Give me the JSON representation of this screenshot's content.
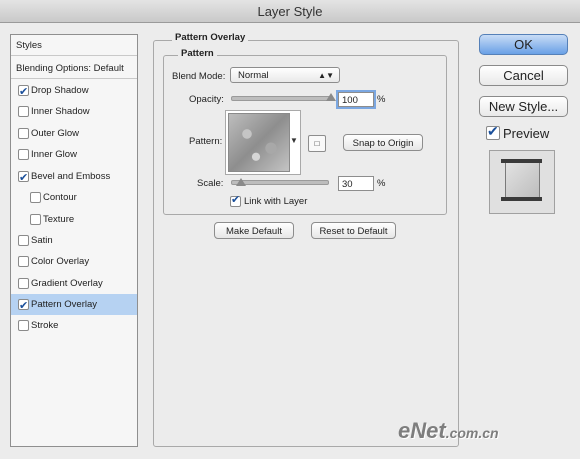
{
  "window": {
    "title": "Layer Style"
  },
  "styles_list": {
    "items": [
      {
        "label": "Styles"
      },
      {
        "label": "Blending Options: Default"
      },
      {
        "label": "Drop Shadow",
        "checked": true
      },
      {
        "label": "Inner Shadow",
        "checked": false
      },
      {
        "label": "Outer Glow",
        "checked": false
      },
      {
        "label": "Inner Glow",
        "checked": false
      },
      {
        "label": "Bevel and Emboss",
        "checked": true
      },
      {
        "label": "Contour",
        "checked": false
      },
      {
        "label": "Texture",
        "checked": false
      },
      {
        "label": "Satin",
        "checked": false
      },
      {
        "label": "Color Overlay",
        "checked": false
      },
      {
        "label": "Gradient Overlay",
        "checked": false
      },
      {
        "label": "Pattern Overlay",
        "checked": true
      },
      {
        "label": "Stroke",
        "checked": false
      }
    ],
    "selected": "Pattern Overlay"
  },
  "pattern_overlay": {
    "group_title": "Pattern Overlay",
    "section_title": "Pattern",
    "blend_mode_label": "Blend Mode:",
    "blend_mode_value": "Normal",
    "opacity_label": "Opacity:",
    "opacity_value": "100",
    "opacity_unit": "%",
    "opacity_level": 1.0,
    "pattern_label": "Pattern:",
    "snap_button": "Snap to Origin",
    "scale_label": "Scale:",
    "scale_value": "30",
    "scale_unit": "%",
    "scale_level": 0.1,
    "link_label": "Link with Layer",
    "link_checked": true,
    "make_default_button": "Make Default",
    "reset_default_button": "Reset to Default"
  },
  "actions": {
    "ok": "OK",
    "cancel": "Cancel",
    "new_style": "New Style...",
    "preview_label": "Preview",
    "preview_checked": true
  },
  "watermark": {
    "brand": "eNet",
    "domain": ".com.cn"
  },
  "colors": {
    "selection": "#b6d2f2",
    "primary_button": "#6aa0e6",
    "checkmark": "#1a4f9a"
  }
}
